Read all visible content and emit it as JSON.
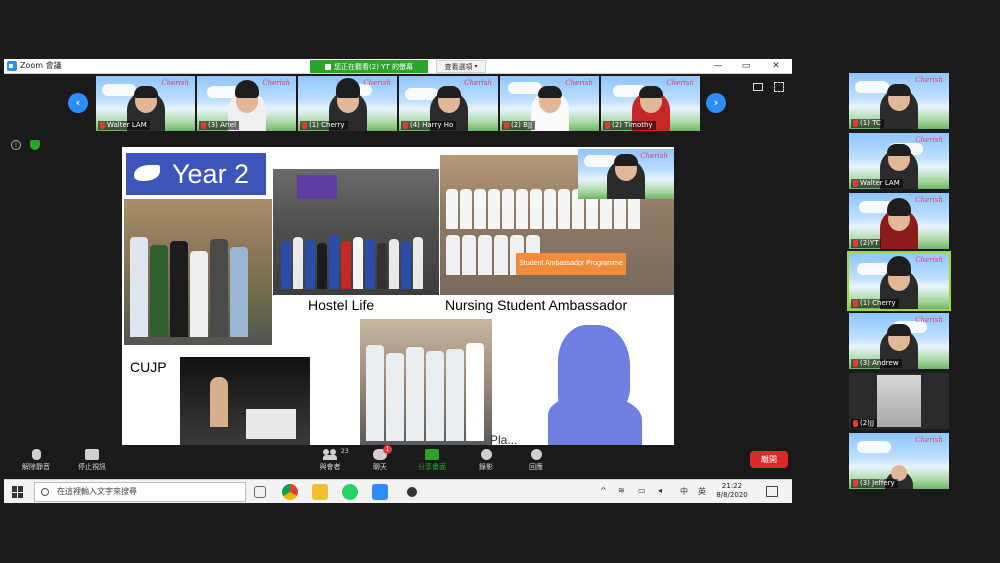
{
  "window": {
    "app_title": "Zoom 會議",
    "speaking_banner": "您正在觀看(2) YT 的螢幕",
    "view_options": "查看選項",
    "minimize": "—",
    "restore": "▭",
    "close": "✕"
  },
  "top_strip": {
    "prev": "‹",
    "next": "›",
    "participants": [
      {
        "name": "Walter LAM",
        "muted": true
      },
      {
        "name": "(3) Ariel",
        "muted": true
      },
      {
        "name": "(1) Cherry",
        "muted": true
      },
      {
        "name": "(4) Harry Ho",
        "muted": true
      },
      {
        "name": "(2) BJJ",
        "muted": true
      },
      {
        "name": "(2) Timothy",
        "muted": true
      }
    ],
    "brand": "Cherish"
  },
  "slide": {
    "title": "Year 2",
    "hostel_label": "Hostel Life",
    "ambassador_label": "Nursing Student Ambassador",
    "banner_text": "Student Ambassador Programme",
    "cujp_label": "CUJP",
    "partial_label": "Pla..."
  },
  "right_strip": {
    "participants": [
      {
        "name": "(1) TC",
        "muted": true,
        "active": false,
        "video": true
      },
      {
        "name": "Walter LAM",
        "muted": true,
        "active": false,
        "video": true
      },
      {
        "name": "(2)YT",
        "muted": true,
        "active": false,
        "video": true
      },
      {
        "name": "(1) Cherry",
        "muted": true,
        "active": true,
        "video": true
      },
      {
        "name": "(3) Andrew",
        "muted": true,
        "active": false,
        "video": true
      },
      {
        "name": "(2)JJ",
        "muted": true,
        "active": false,
        "video": false
      },
      {
        "name": "(3) Jeffery",
        "muted": true,
        "active": false,
        "video": true
      }
    ]
  },
  "controls": {
    "unmute": "解除靜音",
    "stop_video": "停止視訊",
    "participants": "與會者",
    "participants_count": "23",
    "chat": "聊天",
    "chat_badge": "1",
    "share": "分享畫面",
    "record": "錄影",
    "reactions": "回應",
    "end": "離開"
  },
  "taskbar": {
    "search_placeholder": "在這裡輸入文字來搜尋",
    "ime": "中",
    "ime2": "英",
    "time": "21:22",
    "date": "8/8/2020"
  },
  "colors": {
    "zoom_blue": "#2d8cff",
    "speaking_green": "#2aa52a",
    "end_red": "#e02828",
    "active_outline": "#a5d531",
    "slide_header": "#3b55b8"
  }
}
